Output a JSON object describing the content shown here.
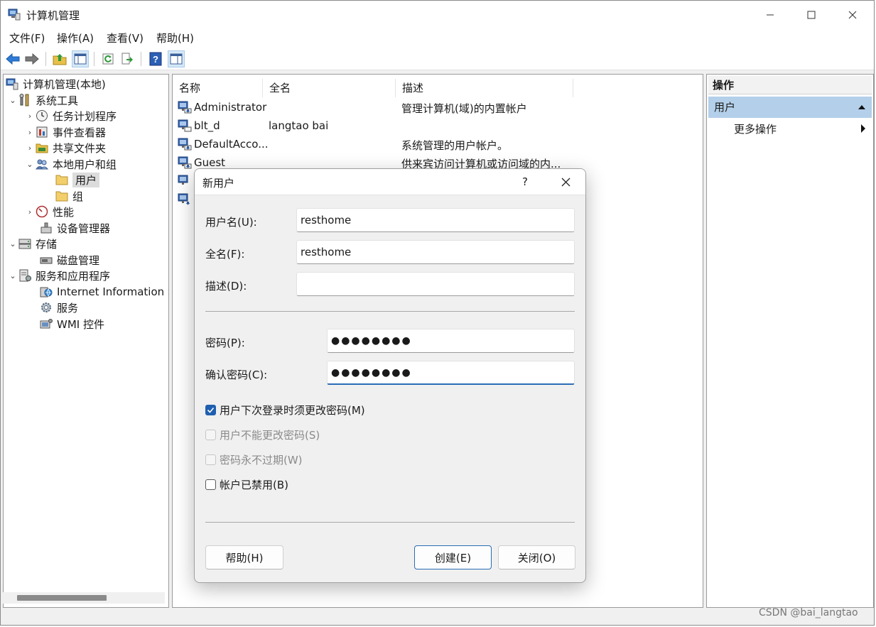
{
  "window": {
    "title": "计算机管理",
    "icon": "computer-management-icon"
  },
  "menubar": {
    "items": [
      "文件(F)",
      "操作(A)",
      "查看(V)",
      "帮助(H)"
    ]
  },
  "toolbar": {
    "icons": [
      "back-arrow-icon",
      "forward-arrow-icon",
      "up-folder-icon",
      "show-hide-console-tree-icon",
      "refresh-icon",
      "export-list-icon",
      "help-icon",
      "show-hide-action-pane-icon"
    ]
  },
  "tree": {
    "root": "计算机管理(本地)",
    "system_tools": "系统工具",
    "task_scheduler": "任务计划程序",
    "event_viewer": "事件查看器",
    "shared_folders": "共享文件夹",
    "local_users_groups": "本地用户和组",
    "users": "用户",
    "groups": "组",
    "performance": "性能",
    "device_manager": "设备管理器",
    "storage": "存储",
    "disk_management": "磁盘管理",
    "services_apps": "服务和应用程序",
    "iis": "Internet Information Se",
    "services": "服务",
    "wmi": "WMI 控件"
  },
  "list": {
    "columns": {
      "name": "名称",
      "fullname": "全名",
      "description": "描述"
    },
    "rows": [
      {
        "name": "Administrator",
        "fullname": "",
        "description": "管理计算机(域)的内置帐户"
      },
      {
        "name": "blt_d",
        "fullname": "langtao bai",
        "description": ""
      },
      {
        "name": "DefaultAcco...",
        "fullname": "",
        "description": "系统管理的用户帐户。"
      },
      {
        "name": "Guest",
        "fullname": "",
        "description": "供来宾访问计算机或访问域的内..."
      }
    ]
  },
  "actions": {
    "header": "操作",
    "section": "用户",
    "more": "更多操作"
  },
  "dialog": {
    "title": "新用户",
    "help_glyph": "?",
    "username": {
      "label": "用户名(U):",
      "value": "resthome"
    },
    "fullname": {
      "label": "全名(F):",
      "value": "resthome"
    },
    "description": {
      "label": "描述(D):",
      "value": ""
    },
    "password": {
      "label": "密码(P):",
      "value": "●●●●●●●●"
    },
    "confirm": {
      "label": "确认密码(C):",
      "value": "●●●●●●●●"
    },
    "checkboxes": [
      {
        "label": "用户下次登录时须更改密码(M)",
        "checked": true,
        "enabled": true
      },
      {
        "label": "用户不能更改密码(S)",
        "checked": false,
        "enabled": false
      },
      {
        "label": "密码永不过期(W)",
        "checked": false,
        "enabled": false
      },
      {
        "label": "帐户已禁用(B)",
        "checked": false,
        "enabled": true
      }
    ],
    "buttons": {
      "help": "帮助(H)",
      "create": "创建(E)",
      "close": "关闭(O)"
    }
  },
  "watermark": "CSDN @bai_langtao",
  "colors": {
    "accent": "#1f5fb0",
    "selection": "#b3cfe9",
    "dialog_bg": "#f0f0f0"
  }
}
